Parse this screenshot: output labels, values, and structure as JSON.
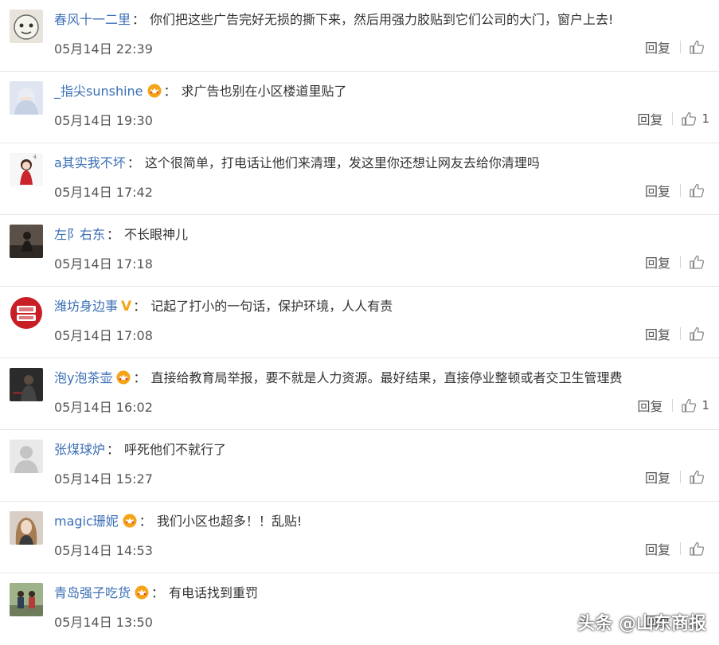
{
  "comments": [
    {
      "user": "春风十一二里",
      "badge": "",
      "text": "你们把这些广告完好无损的撕下来，然后用强力胶贴到它们公司的大门，窗户上去!",
      "date": "05月14日 22:39",
      "reply": "回复",
      "likes": ""
    },
    {
      "user": "_指尖sunshine",
      "badge": "vip",
      "text": "求广告也别在小区楼道里贴了",
      "date": "05月14日 19:30",
      "reply": "回复",
      "likes": "1"
    },
    {
      "user": "a其实我不坏",
      "badge": "",
      "text": "这个很简单，打电话让他们来清理，发这里你还想让网友去给你清理吗",
      "date": "05月14日 17:42",
      "reply": "回复",
      "likes": ""
    },
    {
      "user": "左阝右东",
      "badge": "",
      "text": "不长眼神儿",
      "date": "05月14日 17:18",
      "reply": "回复",
      "likes": ""
    },
    {
      "user": "潍坊身边事",
      "badge": "v",
      "text": "记起了打小的一句话，保护环境，人人有责",
      "date": "05月14日 17:08",
      "reply": "回复",
      "likes": ""
    },
    {
      "user": "泡y泡茶壶",
      "badge": "vip",
      "text": "直接给教育局举报，要不就是人力资源。最好结果，直接停业整顿或者交卫生管理费",
      "date": "05月14日 16:02",
      "reply": "回复",
      "likes": "1"
    },
    {
      "user": "张煤球炉",
      "badge": "",
      "text": "呼死他们不就行了",
      "date": "05月14日 15:27",
      "reply": "回复",
      "likes": ""
    },
    {
      "user": "magic珊妮",
      "badge": "vip",
      "text": "我们小区也超多！！乱贴!",
      "date": "05月14日 14:53",
      "reply": "回复",
      "likes": ""
    },
    {
      "user": "青岛强子吃货",
      "badge": "vip",
      "text": "有电话找到重罚",
      "date": "05月14日 13:50",
      "reply": "回复",
      "likes": ""
    }
  ],
  "badges": {
    "v": "V"
  },
  "watermark": "头条 @山东商报",
  "colors": {
    "username": "#3b6fb6",
    "vip_gold": "#f3a417",
    "text": "#333333",
    "meta": "#555555"
  }
}
